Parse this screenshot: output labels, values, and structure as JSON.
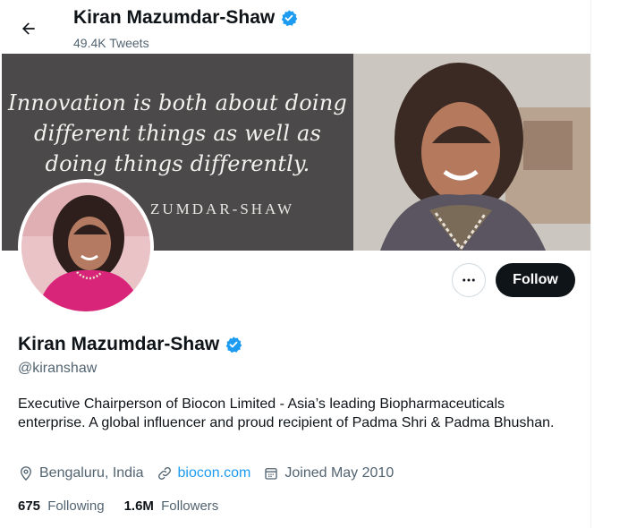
{
  "header": {
    "name": "Kiran Mazumdar-Shaw",
    "tweet_count": "49.4K Tweets"
  },
  "banner": {
    "quote_lines": [
      "Innovation is both about doing",
      "different things as well as",
      "doing things differently."
    ],
    "attribution": "ZUMDAR-SHAW"
  },
  "actions": {
    "follow_label": "Follow"
  },
  "profile": {
    "name": "Kiran Mazumdar-Shaw",
    "handle": "@kiranshaw",
    "bio": "Executive Chairperson of Biocon Limited - Asia’s leading Biopharmaceuticals enterprise. A global influencer and proud recipient of Padma Shri & Padma Bhushan.",
    "location": "Bengaluru, India",
    "website": "biocon.com",
    "joined": "Joined May 2010",
    "following_count": "675",
    "following_label": "Following",
    "followers_count": "1.6M",
    "followers_label": "Followers"
  },
  "colors": {
    "accent": "#1d9bf0",
    "verified": "#1d9bf0",
    "text_primary": "#0f1419",
    "text_secondary": "#536471"
  },
  "icons": {
    "back": "arrow-left-icon",
    "verified": "verified-badge-icon",
    "more": "more-dots-icon",
    "location": "location-pin-icon",
    "link": "link-icon",
    "calendar": "calendar-icon"
  }
}
